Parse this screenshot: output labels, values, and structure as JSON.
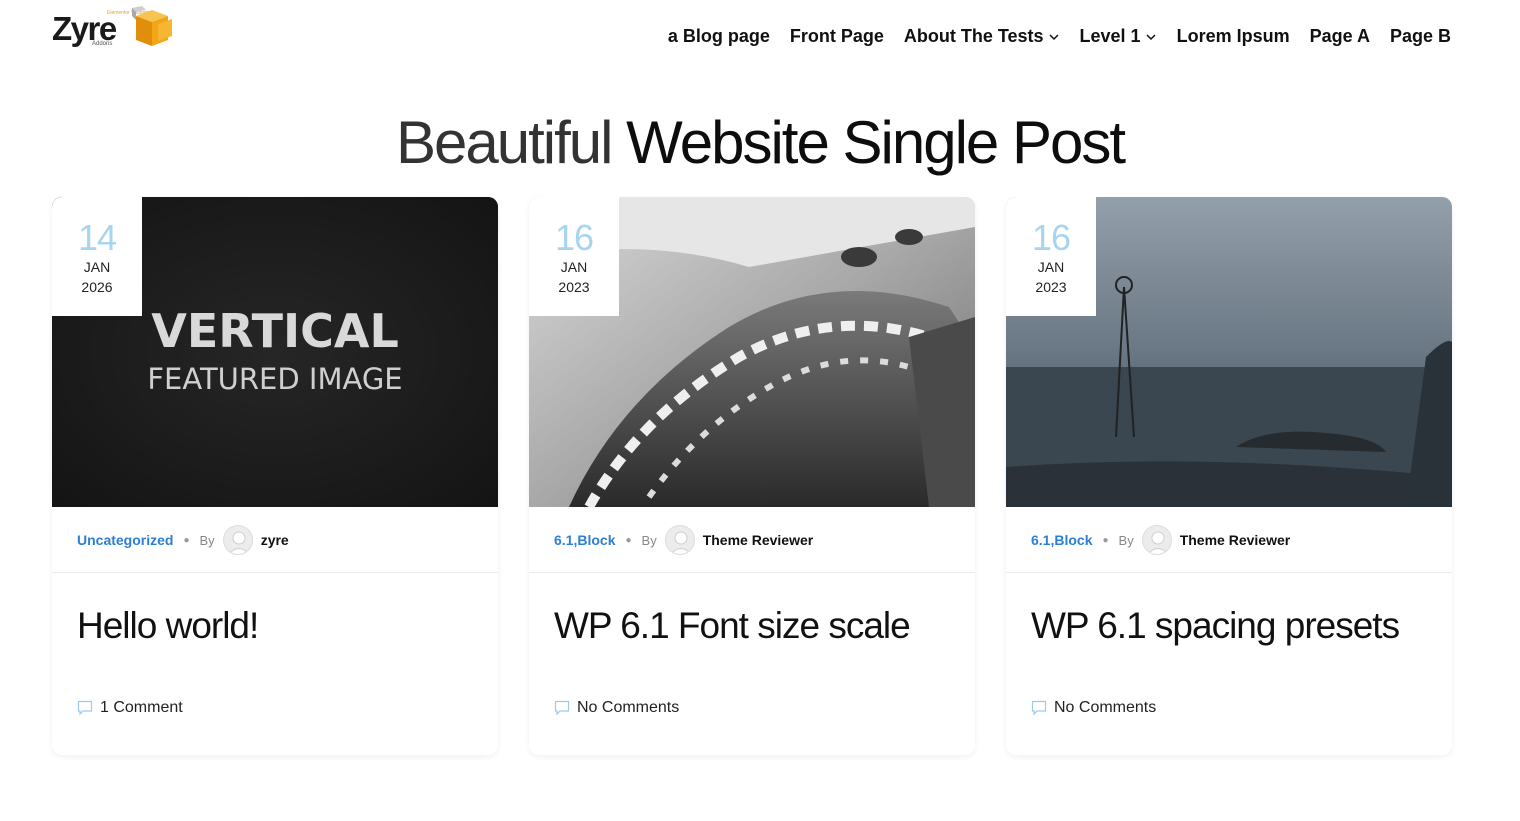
{
  "logo": {
    "text": "Zyre",
    "tagline": "Elementor Widgets",
    "sub": "Addons"
  },
  "nav": [
    {
      "label": "a Blog page",
      "has_dropdown": false
    },
    {
      "label": "Front Page",
      "has_dropdown": false
    },
    {
      "label": "About The Tests",
      "has_dropdown": true
    },
    {
      "label": "Level 1",
      "has_dropdown": true
    },
    {
      "label": "Lorem Ipsum",
      "has_dropdown": false
    },
    {
      "label": "Page A",
      "has_dropdown": false
    },
    {
      "label": "Page B",
      "has_dropdown": false
    }
  ],
  "page_title": {
    "part1": "Beautiful",
    "part2": "Website Single Post"
  },
  "posts": [
    {
      "day": "14",
      "month": "JAN",
      "year": "2026",
      "thumb_line1": "VERTICAL",
      "thumb_line2": "FEATURED IMAGE",
      "categories": "Uncategorized",
      "by": "By",
      "author": "zyre",
      "title": "Hello world!",
      "comments": "1 Comment"
    },
    {
      "day": "16",
      "month": "JAN",
      "year": "2023",
      "categories_a": "6.1",
      "categories_sep": ", ",
      "categories_b": "Block",
      "by": "By",
      "author": "Theme Reviewer",
      "title": "WP 6.1 Font size scale",
      "comments": "No Comments"
    },
    {
      "day": "16",
      "month": "JAN",
      "year": "2023",
      "categories_a": "6.1",
      "categories_sep": ", ",
      "categories_b": "Block",
      "by": "By",
      "author": "Theme Reviewer",
      "title": "WP 6.1 spacing presets",
      "comments": "No Comments"
    }
  ],
  "colors": {
    "accent": "#2c7fd6",
    "date_day": "#a9d4ef",
    "logo_box": "#f2a516"
  }
}
